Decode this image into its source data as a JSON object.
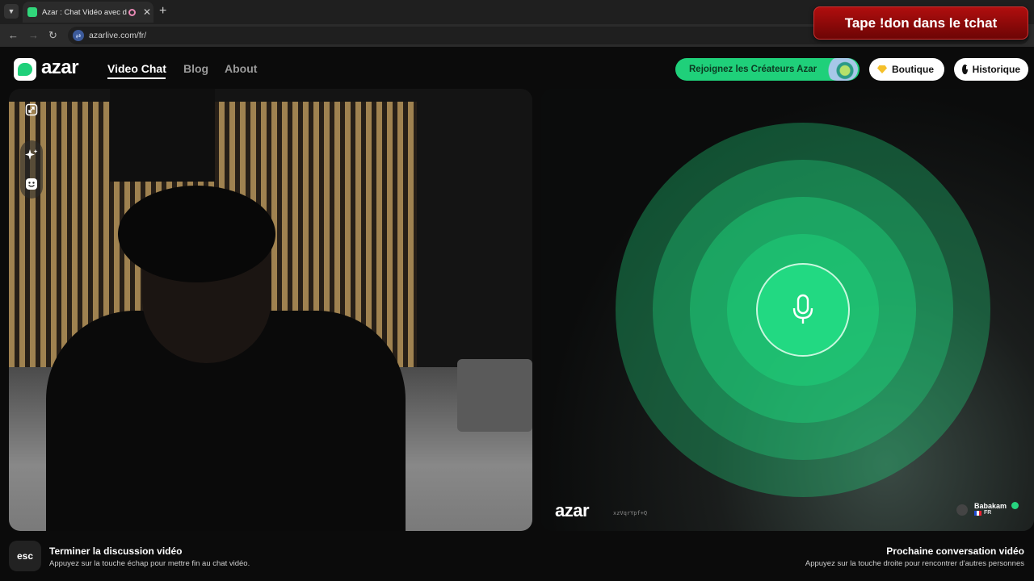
{
  "browser": {
    "tab_title": "Azar : Chat Vidéo avec de n",
    "tab_close": "✕",
    "new_tab": "+",
    "url": "azarlive.com/fr/"
  },
  "overlay": {
    "banner_text": "Tape !don dans le tchat"
  },
  "header": {
    "logo_text": "azar",
    "nav": [
      {
        "label": "Video Chat",
        "active": true
      },
      {
        "label": "Blog",
        "active": false
      },
      {
        "label": "About",
        "active": false
      }
    ],
    "creators_button": "Rejoignez les Créateurs Azar",
    "shop_button": "Boutique",
    "history_button": "Historique"
  },
  "right_panel": {
    "watermark_logo": "azar",
    "watermark_code": "xzVqrYpf+Q",
    "user_name": "Babakam",
    "user_country": "FR"
  },
  "footer": {
    "esc_key": "esc",
    "end_title": "Terminer la discussion vidéo",
    "end_sub": "Appuyez sur la touche échap pour mettre fin au chat vidéo.",
    "next_title": "Prochaine conversation vidéo",
    "next_sub": "Appuyez sur la touche droite pour rencontrer d'autres personnes"
  },
  "colors": {
    "brand_green": "#1fd07a",
    "banner_red": "#9b0b0b"
  }
}
